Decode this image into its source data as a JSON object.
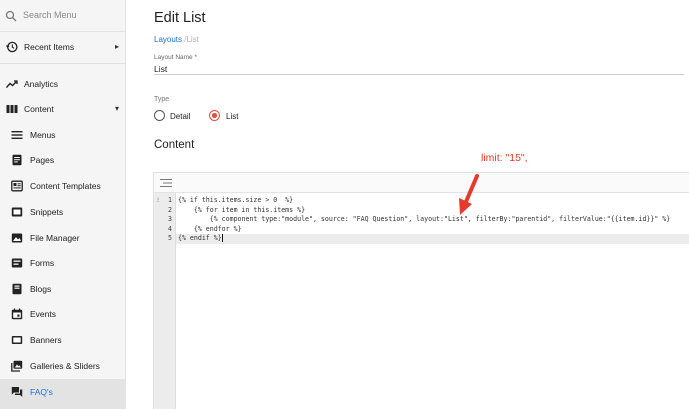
{
  "sidebar": {
    "search_placeholder": "Search Menu",
    "items": [
      {
        "label": "Recent Items",
        "icon": "history-icon",
        "expand": "▸"
      },
      {
        "label": "Analytics",
        "icon": "trending-up-icon"
      },
      {
        "label": "Content",
        "icon": "columns-icon",
        "expand": "▾"
      },
      {
        "label": "Menus",
        "icon": "menu-icon"
      },
      {
        "label": "Pages",
        "icon": "page-icon"
      },
      {
        "label": "Content Templates",
        "icon": "template-icon"
      },
      {
        "label": "Snippets",
        "icon": "snippet-icon"
      },
      {
        "label": "File Manager",
        "icon": "image-icon"
      },
      {
        "label": "Forms",
        "icon": "form-icon"
      },
      {
        "label": "Blogs",
        "icon": "book-icon"
      },
      {
        "label": "Events",
        "icon": "calendar-icon"
      },
      {
        "label": "Banners",
        "icon": "banner-icon"
      },
      {
        "label": "Galleries & Sliders",
        "icon": "gallery-icon"
      },
      {
        "label": "FAQ's",
        "icon": "faq-icon",
        "active": true
      }
    ]
  },
  "main": {
    "title": "Edit List",
    "breadcrumb": {
      "link": "Layouts",
      "sep": " /",
      "current": "List"
    },
    "layout_name": {
      "label": "Layout Name *",
      "value": "List"
    },
    "type": {
      "label": "Type",
      "options": [
        "Detail",
        "List"
      ],
      "selected": "List"
    },
    "content_heading": "Content",
    "annotation": "limit: \"15\","
  },
  "editor": {
    "gutter": [
      "1",
      "2",
      "3",
      "4",
      "5"
    ],
    "fold_marker": "⁝",
    "active_line": 5,
    "lines": [
      "{% if this.items.size > 0  %}",
      "    {% for item in this.items %}",
      "        {% component type:\"module\", source: \"FAQ Question\", layout:\"List\", filterBy:\"parentid\", filterValue:\"{{item.id}}\" %}",
      "    {% endfor %}",
      "{% endif %}"
    ]
  },
  "colors": {
    "accent": "#1f6fd6",
    "radio_selected": "#e74c3c",
    "annotation": "#e53b2c",
    "keyword": "#1f4fb8",
    "string": "#1b6ea8"
  }
}
